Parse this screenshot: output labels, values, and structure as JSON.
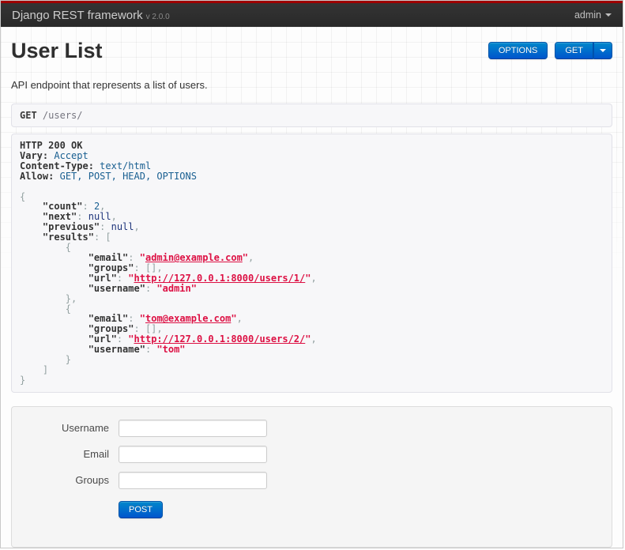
{
  "navbar": {
    "brand": "Django REST framework",
    "version": "v 2.0.0",
    "user_menu_label": "admin"
  },
  "page": {
    "title": "User List",
    "description": "API endpoint that represents a list of users."
  },
  "toolbar": {
    "options_label": "OPTIONS",
    "get_label": "GET"
  },
  "request": {
    "method": "GET",
    "path": "/users/"
  },
  "response": {
    "status": "HTTP 200 OK",
    "headers": [
      {
        "name": "Vary",
        "value": "Accept"
      },
      {
        "name": "Content-Type",
        "value": "text/html"
      },
      {
        "name": "Allow",
        "value": "GET, POST, HEAD, OPTIONS"
      }
    ],
    "body_data": {
      "count": 2,
      "next": null,
      "previous": null,
      "results": [
        {
          "email": "admin@example.com",
          "groups": [],
          "url": "http://127.0.0.1:8000/users/1/",
          "username": "admin"
        },
        {
          "email": "tom@example.com",
          "groups": [],
          "url": "http://127.0.0.1:8000/users/2/",
          "username": "tom"
        }
      ]
    },
    "lines": [
      [
        [
          "b",
          "HTTP 200 OK"
        ]
      ],
      [
        [
          "b",
          "Vary:"
        ],
        [
          "w",
          " "
        ],
        [
          "h",
          "Accept"
        ]
      ],
      [
        [
          "b",
          "Content-Type:"
        ],
        [
          "w",
          " "
        ],
        [
          "h",
          "text/html"
        ]
      ],
      [
        [
          "b",
          "Allow:"
        ],
        [
          "w",
          " "
        ],
        [
          "h",
          "GET, POST, HEAD, OPTIONS"
        ]
      ],
      [],
      [
        [
          "p",
          "{"
        ]
      ],
      [
        [
          "w",
          "    "
        ],
        [
          "b",
          "\"count\""
        ],
        [
          "p",
          ": "
        ],
        [
          "n",
          "2"
        ],
        [
          "p",
          ","
        ]
      ],
      [
        [
          "w",
          "    "
        ],
        [
          "b",
          "\"next\""
        ],
        [
          "p",
          ": "
        ],
        [
          "k",
          "null"
        ],
        [
          "p",
          ","
        ]
      ],
      [
        [
          "w",
          "    "
        ],
        [
          "b",
          "\"previous\""
        ],
        [
          "p",
          ": "
        ],
        [
          "k",
          "null"
        ],
        [
          "p",
          ","
        ]
      ],
      [
        [
          "w",
          "    "
        ],
        [
          "b",
          "\"results\""
        ],
        [
          "p",
          ": ["
        ]
      ],
      [
        [
          "w",
          "        "
        ],
        [
          "p",
          "{"
        ]
      ],
      [
        [
          "w",
          "            "
        ],
        [
          "b",
          "\"email\""
        ],
        [
          "p",
          ": "
        ],
        [
          "s",
          "\""
        ],
        [
          "a",
          "admin@example.com"
        ],
        [
          "s",
          "\""
        ],
        [
          "p",
          ","
        ]
      ],
      [
        [
          "w",
          "            "
        ],
        [
          "b",
          "\"groups\""
        ],
        [
          "p",
          ": [],"
        ]
      ],
      [
        [
          "w",
          "            "
        ],
        [
          "b",
          "\"url\""
        ],
        [
          "p",
          ": "
        ],
        [
          "s",
          "\""
        ],
        [
          "a",
          "http://127.0.0.1:8000/users/1/"
        ],
        [
          "s",
          "\""
        ],
        [
          "p",
          ","
        ]
      ],
      [
        [
          "w",
          "            "
        ],
        [
          "b",
          "\"username\""
        ],
        [
          "p",
          ": "
        ],
        [
          "s",
          "\"admin\""
        ]
      ],
      [
        [
          "w",
          "        "
        ],
        [
          "p",
          "},"
        ]
      ],
      [
        [
          "w",
          "        "
        ],
        [
          "p",
          "{"
        ]
      ],
      [
        [
          "w",
          "            "
        ],
        [
          "b",
          "\"email\""
        ],
        [
          "p",
          ": "
        ],
        [
          "s",
          "\""
        ],
        [
          "a",
          "tom@example.com"
        ],
        [
          "s",
          "\""
        ],
        [
          "p",
          ","
        ]
      ],
      [
        [
          "w",
          "            "
        ],
        [
          "b",
          "\"groups\""
        ],
        [
          "p",
          ": [],"
        ]
      ],
      [
        [
          "w",
          "            "
        ],
        [
          "b",
          "\"url\""
        ],
        [
          "p",
          ": "
        ],
        [
          "s",
          "\""
        ],
        [
          "a",
          "http://127.0.0.1:8000/users/2/"
        ],
        [
          "s",
          "\""
        ],
        [
          "p",
          ","
        ]
      ],
      [
        [
          "w",
          "            "
        ],
        [
          "b",
          "\"username\""
        ],
        [
          "p",
          ": "
        ],
        [
          "s",
          "\"tom\""
        ]
      ],
      [
        [
          "w",
          "        "
        ],
        [
          "p",
          "}"
        ]
      ],
      [
        [
          "w",
          "    "
        ],
        [
          "p",
          "]"
        ]
      ],
      [
        [
          "p",
          "}"
        ]
      ]
    ]
  },
  "form": {
    "fields": [
      {
        "label": "Username"
      },
      {
        "label": "Email"
      },
      {
        "label": "Groups"
      }
    ],
    "submit_label": "POST"
  },
  "colors": {
    "brand_red": "#9e0000",
    "navbar_bg": "#2d2d2d",
    "accent_blue": "#0088cc",
    "link_crimson": "#dd1144",
    "keyword_navy": "#1e347b",
    "number_blue": "#195f91",
    "punctuation_gray": "#93a1a1",
    "panel_bg": "#f7f7f9"
  }
}
